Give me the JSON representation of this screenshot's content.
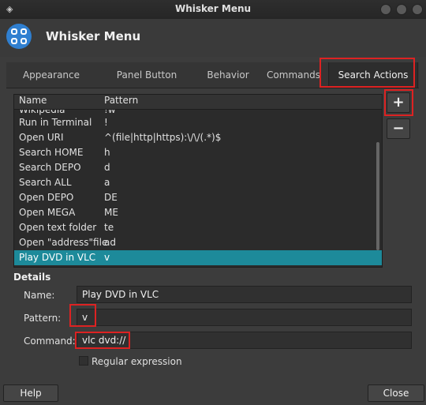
{
  "window": {
    "title": "Whisker Menu"
  },
  "header": {
    "title": "Whisker Menu"
  },
  "tabs": [
    {
      "label": "Appearance"
    },
    {
      "label": "Panel Button"
    },
    {
      "label": "Behavior"
    },
    {
      "label": "Commands"
    },
    {
      "label": "Search Actions"
    }
  ],
  "list": {
    "columns": {
      "name": "Name",
      "pattern": "Pattern"
    },
    "rows": [
      {
        "name": "Wikipedia",
        "pattern": "!w"
      },
      {
        "name": "Run in Terminal",
        "pattern": "!"
      },
      {
        "name": "Open URI",
        "pattern": "^(file|http|https):\\/\\/(.*)$"
      },
      {
        "name": "Search HOME",
        "pattern": "h"
      },
      {
        "name": "Search DEPO",
        "pattern": "d"
      },
      {
        "name": "Search ALL",
        "pattern": "a"
      },
      {
        "name": "Open DEPO",
        "pattern": "DE"
      },
      {
        "name": "Open MEGA",
        "pattern": "ME"
      },
      {
        "name": "Open text folder",
        "pattern": "te"
      },
      {
        "name": "Open \"address\"file",
        "pattern": "ad"
      },
      {
        "name": "Play DVD in VLC",
        "pattern": "v"
      }
    ]
  },
  "buttons": {
    "add": "+",
    "remove": "−",
    "help": "Help",
    "close": "Close"
  },
  "details": {
    "title": "Details",
    "name_label": "Name:",
    "name_value": "Play DVD in VLC",
    "pattern_label": "Pattern:",
    "pattern_value": "v",
    "command_label": "Command:",
    "command_value": "vlc dvd://",
    "regex_label": "Regular expression"
  }
}
